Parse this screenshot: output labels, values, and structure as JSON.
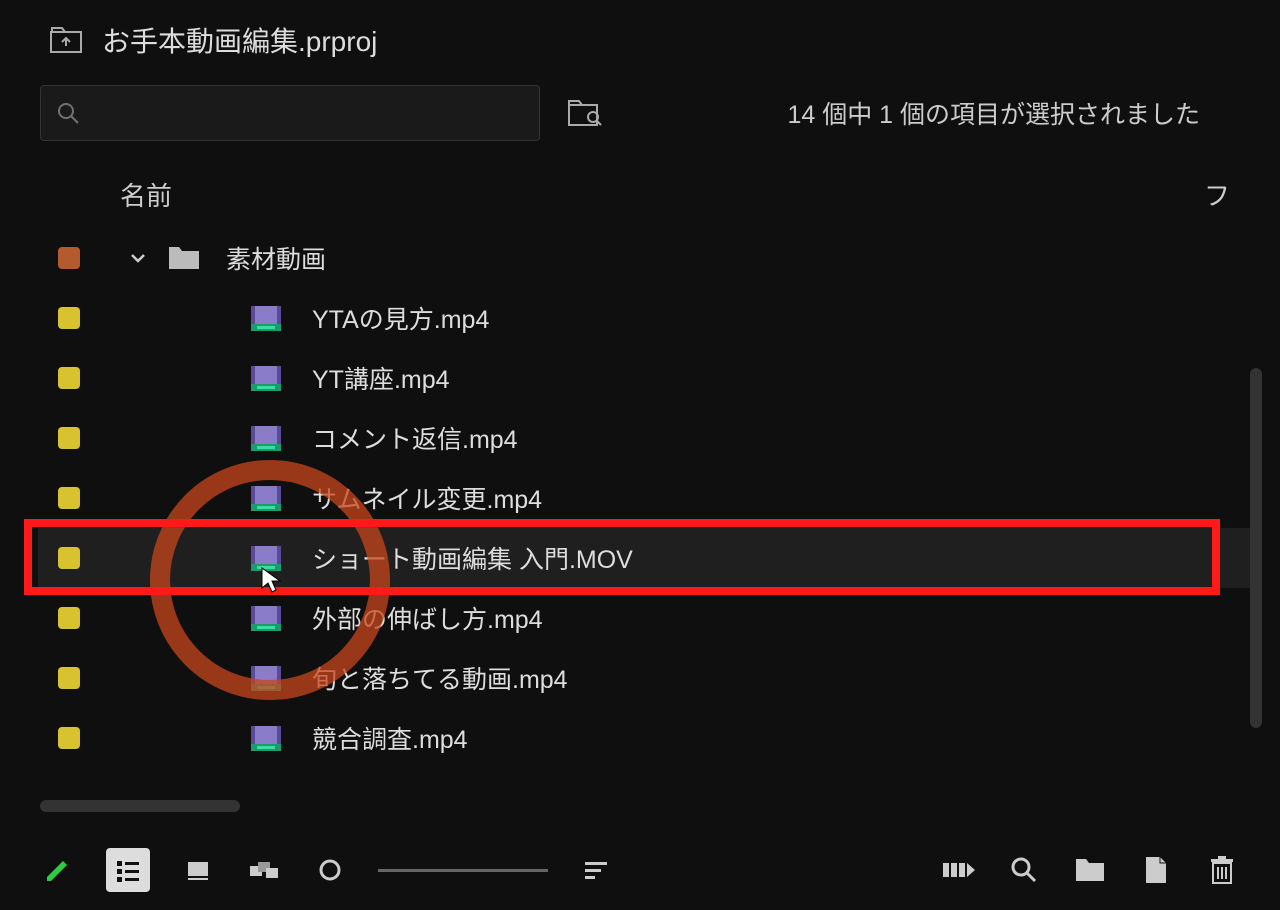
{
  "project": {
    "title": "お手本動画編集.prproj"
  },
  "search": {
    "placeholder": ""
  },
  "status": {
    "selection": "14 個中 1 個の項目が選択されました"
  },
  "columns": {
    "name": "名前",
    "right": "フ"
  },
  "bin": {
    "name": "素材動画",
    "color": "orange",
    "expanded": true,
    "items": [
      {
        "name": "YTAの見方.mp4",
        "color": "yellow"
      },
      {
        "name": "YT講座.mp4",
        "color": "yellow"
      },
      {
        "name": "コメント返信.mp4",
        "color": "yellow"
      },
      {
        "name": "サムネイル変更.mp4",
        "color": "yellow"
      },
      {
        "name": "ショート動画編集 入門.MOV",
        "color": "yellow",
        "selected": true
      },
      {
        "name": "外部の伸ばし方.mp4",
        "color": "yellow"
      },
      {
        "name": "旬と落ちてる動画.mp4",
        "color": "yellow"
      },
      {
        "name": "競合調査.mp4",
        "color": "yellow"
      }
    ]
  },
  "toolbar": {
    "pencil": "pencil",
    "list_view": "list-view",
    "icon_view": "icon-view",
    "freeform": "freeform",
    "zoom_out": "zoom-out",
    "sort": "sort",
    "automate": "automate",
    "find": "find",
    "new_bin": "new-bin",
    "new_item": "new-item",
    "delete": "delete"
  }
}
